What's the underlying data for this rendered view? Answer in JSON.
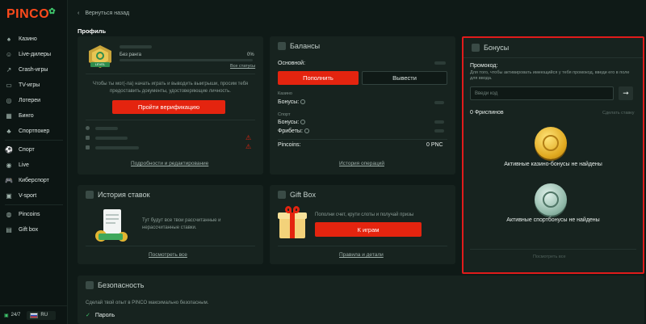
{
  "brand": {
    "name": "PINC",
    "leaf": "✿"
  },
  "sidebar": {
    "items": [
      {
        "label": "Казино",
        "icon": "casino-icon"
      },
      {
        "label": "Live-дилеры",
        "icon": "live-dealer-icon"
      },
      {
        "label": "Crash-игры",
        "icon": "crash-icon"
      },
      {
        "label": "TV-игры",
        "icon": "tv-icon"
      },
      {
        "label": "Лотереи",
        "icon": "lottery-icon"
      },
      {
        "label": "Бинго",
        "icon": "bingo-icon"
      },
      {
        "label": "Спортпокер",
        "icon": "poker-icon"
      },
      {
        "label": "Спорт",
        "icon": "sport-icon"
      },
      {
        "label": "Live",
        "icon": "live-icon"
      },
      {
        "label": "Киберспорт",
        "icon": "esport-icon"
      },
      {
        "label": "V-sport",
        "icon": "vsport-icon"
      },
      {
        "label": "Pincoins",
        "icon": "pincoin-icon"
      },
      {
        "label": "Gift box",
        "icon": "gift-icon"
      }
    ],
    "support": "24/7",
    "language": "RU"
  },
  "header": {
    "back_label": "Вернуться назад",
    "page_title": "Профиль"
  },
  "profile": {
    "level_badge": "LEVEL",
    "rank_label": "Без ранга",
    "rank_progress": "0%",
    "rank_progress_value": 0,
    "all_statuses": "Все статусы",
    "verify_text": "Чтобы ты мог(-ла) начать играть и выводить выигрыши, просим тебя предоставить документы, удостоверяющие личность.",
    "verify_button": "Пройти верификацию",
    "details_link": "Подробности и редактирование"
  },
  "balances": {
    "title": "Балансы",
    "main_label": "Основной:",
    "deposit_button": "Пополнить",
    "withdraw_button": "Вывести",
    "casino_section": "Казино",
    "casino_bonuses": "Бонусы:",
    "sport_section": "Спорт",
    "sport_bonuses": "Бонусы:",
    "freebets": "Фрибеты:",
    "pincoins_label": "Pincoins:",
    "pincoins_value": "0 PNC",
    "history_link": "История операций"
  },
  "bonuses": {
    "title": "Бонусы",
    "promo_label": "Промокод:",
    "promo_hint": "Для того, чтобы активировать имеющийся у тебя промокод, введи его в поле для ввода.",
    "promo_placeholder": "Введи код",
    "freespins": "0  Фриспинов",
    "freespins_link": "Сделать ставку",
    "casino_empty": "Активные казино-бонусы не найдены",
    "sport_empty": "Активные спортбонусы не найдены",
    "all_link": "Посмотреть все"
  },
  "bet_history": {
    "title": "История ставок",
    "text": "Тут будут все твои рассчитанные и нерассчитанные ставки.",
    "link": "Посмотреть все"
  },
  "giftbox": {
    "title": "Gift Box",
    "text": "Пополни счет, крути слоты и получай призы",
    "button": "К играм",
    "link": "Правила и детали"
  },
  "security": {
    "title": "Безопасность",
    "text": "Сделай твой опыт в PINCO максимально безопасным.",
    "password_item": "Пароль"
  },
  "colors": {
    "accent": "#e4240f",
    "bg": "#0f1a17",
    "card": "#17231f",
    "highlight": "#e01b1b",
    "brand_green": "#3fc46b"
  }
}
